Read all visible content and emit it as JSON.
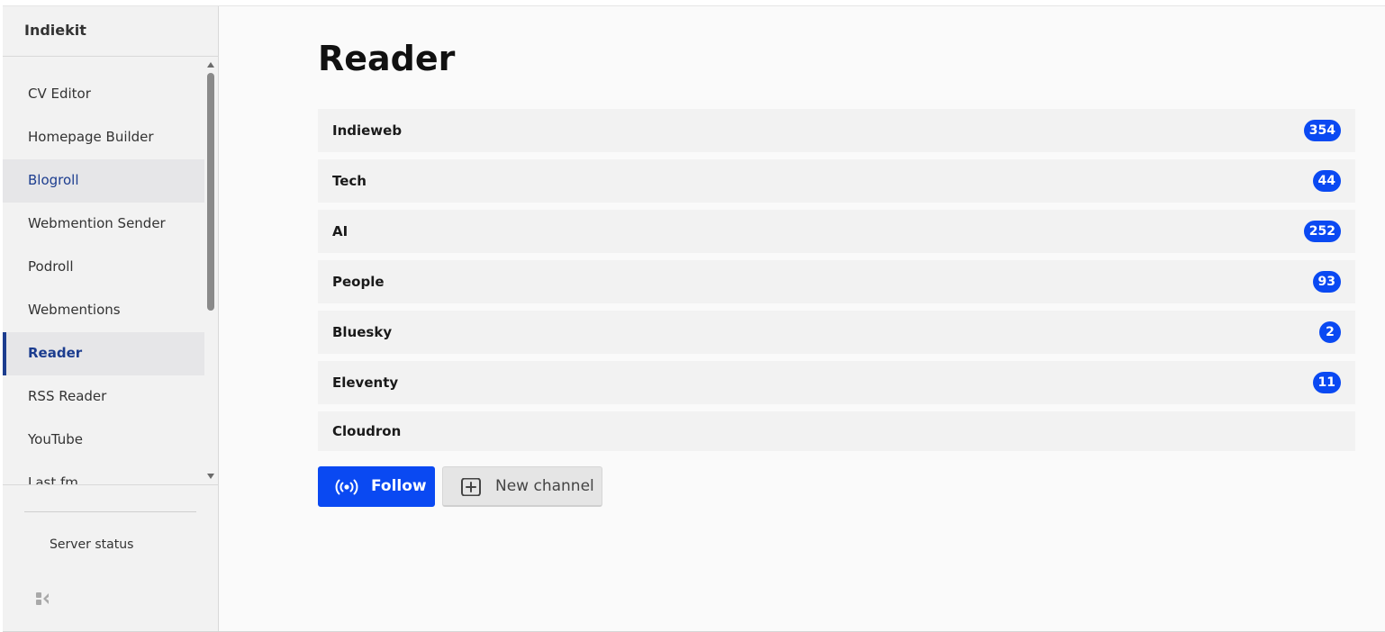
{
  "app": {
    "name": "Indiekit"
  },
  "sidebar": {
    "items": [
      {
        "label": "CV Editor",
        "state": "normal"
      },
      {
        "label": "Homepage Builder",
        "state": "normal"
      },
      {
        "label": "Blogroll",
        "state": "hover"
      },
      {
        "label": "Webmention Sender",
        "state": "normal"
      },
      {
        "label": "Podroll",
        "state": "normal"
      },
      {
        "label": "Webmentions",
        "state": "normal"
      },
      {
        "label": "Reader",
        "state": "active"
      },
      {
        "label": "RSS Reader",
        "state": "normal"
      },
      {
        "label": "YouTube",
        "state": "normal"
      },
      {
        "label": "Last.fm",
        "state": "normal"
      }
    ],
    "footer": {
      "server_status": "Server status",
      "logo_icon": "indiekit-logo-icon"
    }
  },
  "main": {
    "title": "Reader",
    "channels": [
      {
        "name": "Indieweb",
        "unread": "354"
      },
      {
        "name": "Tech",
        "unread": "44"
      },
      {
        "name": "AI",
        "unread": "252"
      },
      {
        "name": "People",
        "unread": "93"
      },
      {
        "name": "Bluesky",
        "unread": "2"
      },
      {
        "name": "Eleventy",
        "unread": "11"
      },
      {
        "name": "Cloudron",
        "unread": ""
      }
    ],
    "actions": {
      "follow_label": "Follow",
      "follow_icon": "broadcast-icon",
      "new_channel_label": "New channel",
      "new_channel_icon": "plus-square-icon"
    }
  },
  "colors": {
    "accent": "#0a49f2",
    "active_nav": "#1c3d8f"
  }
}
